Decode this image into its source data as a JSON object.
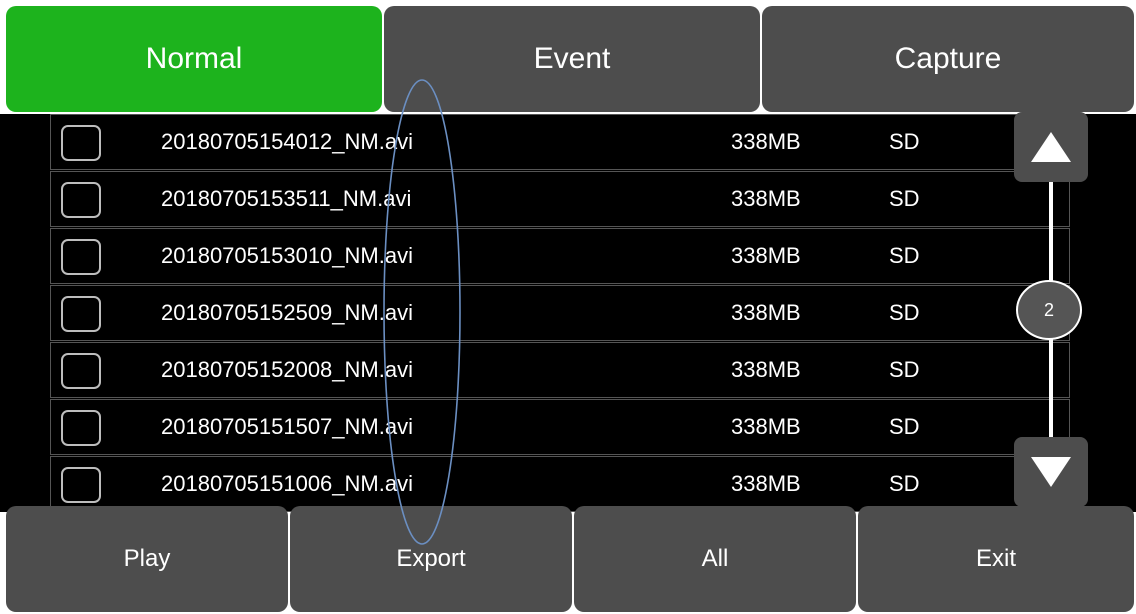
{
  "tabs": [
    {
      "label": "Normal",
      "active": true
    },
    {
      "label": "Event",
      "active": false
    },
    {
      "label": "Capture",
      "active": false
    }
  ],
  "files": [
    {
      "name": "20180705154012_NM.avi",
      "size": "338MB",
      "source": "SD",
      "checked": false
    },
    {
      "name": "20180705153511_NM.avi",
      "size": "338MB",
      "source": "SD",
      "checked": false
    },
    {
      "name": "20180705153010_NM.avi",
      "size": "338MB",
      "source": "SD",
      "checked": false
    },
    {
      "name": "20180705152509_NM.avi",
      "size": "338MB",
      "source": "SD",
      "checked": false
    },
    {
      "name": "20180705152008_NM.avi",
      "size": "338MB",
      "source": "SD",
      "checked": false
    },
    {
      "name": "20180705151507_NM.avi",
      "size": "338MB",
      "source": "SD",
      "checked": false
    },
    {
      "name": "20180705151006_NM.avi",
      "size": "338MB",
      "source": "SD",
      "checked": false
    }
  ],
  "scrollbar": {
    "page": "2",
    "up_icon": "triangle-up-icon",
    "down_icon": "triangle-down-icon"
  },
  "buttons": {
    "play": "Play",
    "export": "Export",
    "all": "All",
    "exit": "Exit"
  },
  "colors": {
    "active_tab": "#1db31d",
    "panel": "#4d4d4d",
    "list_background": "#000000",
    "annotation_ellipse": "#6b8fc2"
  }
}
